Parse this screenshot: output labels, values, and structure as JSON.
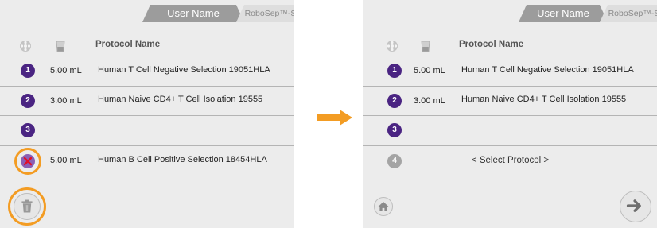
{
  "left_screen": {
    "header": {
      "user_tab": "User Name",
      "brand_tab": "RoboSep™-S"
    },
    "column_header": {
      "protocol_name": "Protocol Name",
      "carousel_icon": "carousel-icon",
      "tube_icon": "tube-icon"
    },
    "rows": [
      {
        "number": "1",
        "volume": "5.00 mL",
        "protocol": "Human T Cell Negative Selection 19051HLA"
      },
      {
        "number": "2",
        "volume": "3.00 mL",
        "protocol": "Human Naive CD4+ T Cell Isolation 19555"
      },
      {
        "number": "3",
        "volume": "",
        "protocol": ""
      },
      {
        "number": "",
        "volume": "5.00 mL",
        "protocol": "Human B Cell Positive Selection 18454HLA",
        "delete_icon": "x-delete-icon"
      }
    ],
    "bottom": {
      "delete_button_icon": "trash-icon"
    }
  },
  "transition_arrow": {
    "icon": "arrow-right-icon",
    "color": "#f39c23"
  },
  "right_screen": {
    "header": {
      "user_tab": "User Name",
      "brand_tab": "RoboSep™-S"
    },
    "column_header": {
      "protocol_name": "Protocol Name",
      "carousel_icon": "carousel-icon",
      "tube_icon": "tube-icon"
    },
    "rows": [
      {
        "number": "1",
        "volume": "5.00 mL",
        "protocol": "Human T Cell Negative Selection 19051HLA"
      },
      {
        "number": "2",
        "volume": "3.00 mL",
        "protocol": "Human Naive CD4+ T Cell Isolation 19555"
      },
      {
        "number": "3",
        "volume": "",
        "protocol": ""
      },
      {
        "number": "4",
        "volume": "",
        "protocol": "< Select Protocol >"
      }
    ],
    "bottom": {
      "home_button_icon": "home-icon",
      "next_button_icon": "arrow-right-icon"
    }
  },
  "colors": {
    "quadrant_purple": "#4a2482",
    "highlight_orange": "#f39c23",
    "panel_bg": "#ececec",
    "inactive_grey": "#a4a4a4"
  }
}
